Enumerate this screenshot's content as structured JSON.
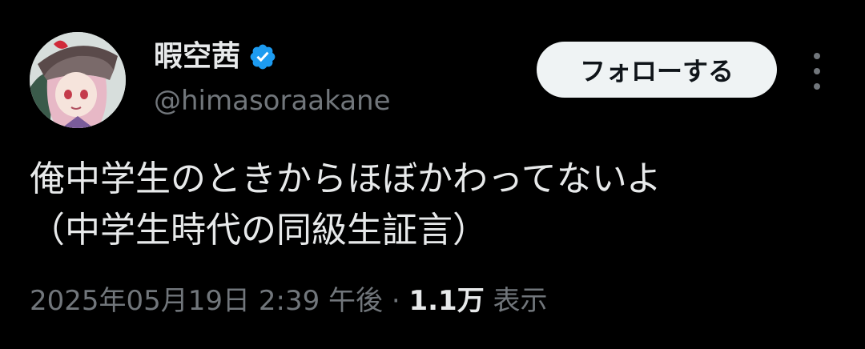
{
  "tweet": {
    "display_name": "暇空茜",
    "handle": "@himasoraakane",
    "verified": true,
    "follow_label": "フォローする",
    "text_line1": "俺中学生のときからほぼかわってないよ",
    "text_line2": "（中学生時代の同級生証言）",
    "timestamp": "2025年05月19日 2:39 午後",
    "separator": "·",
    "views_count": "1.1万",
    "views_label": "表示"
  },
  "icons": {
    "verified": "verified-badge-icon",
    "more": "more-options-icon"
  },
  "colors": {
    "background": "#000000",
    "primary_text": "#e7e9ea",
    "secondary_text": "#71767b",
    "verified_blue": "#1d9bf0",
    "follow_button_bg": "#eff3f4"
  }
}
